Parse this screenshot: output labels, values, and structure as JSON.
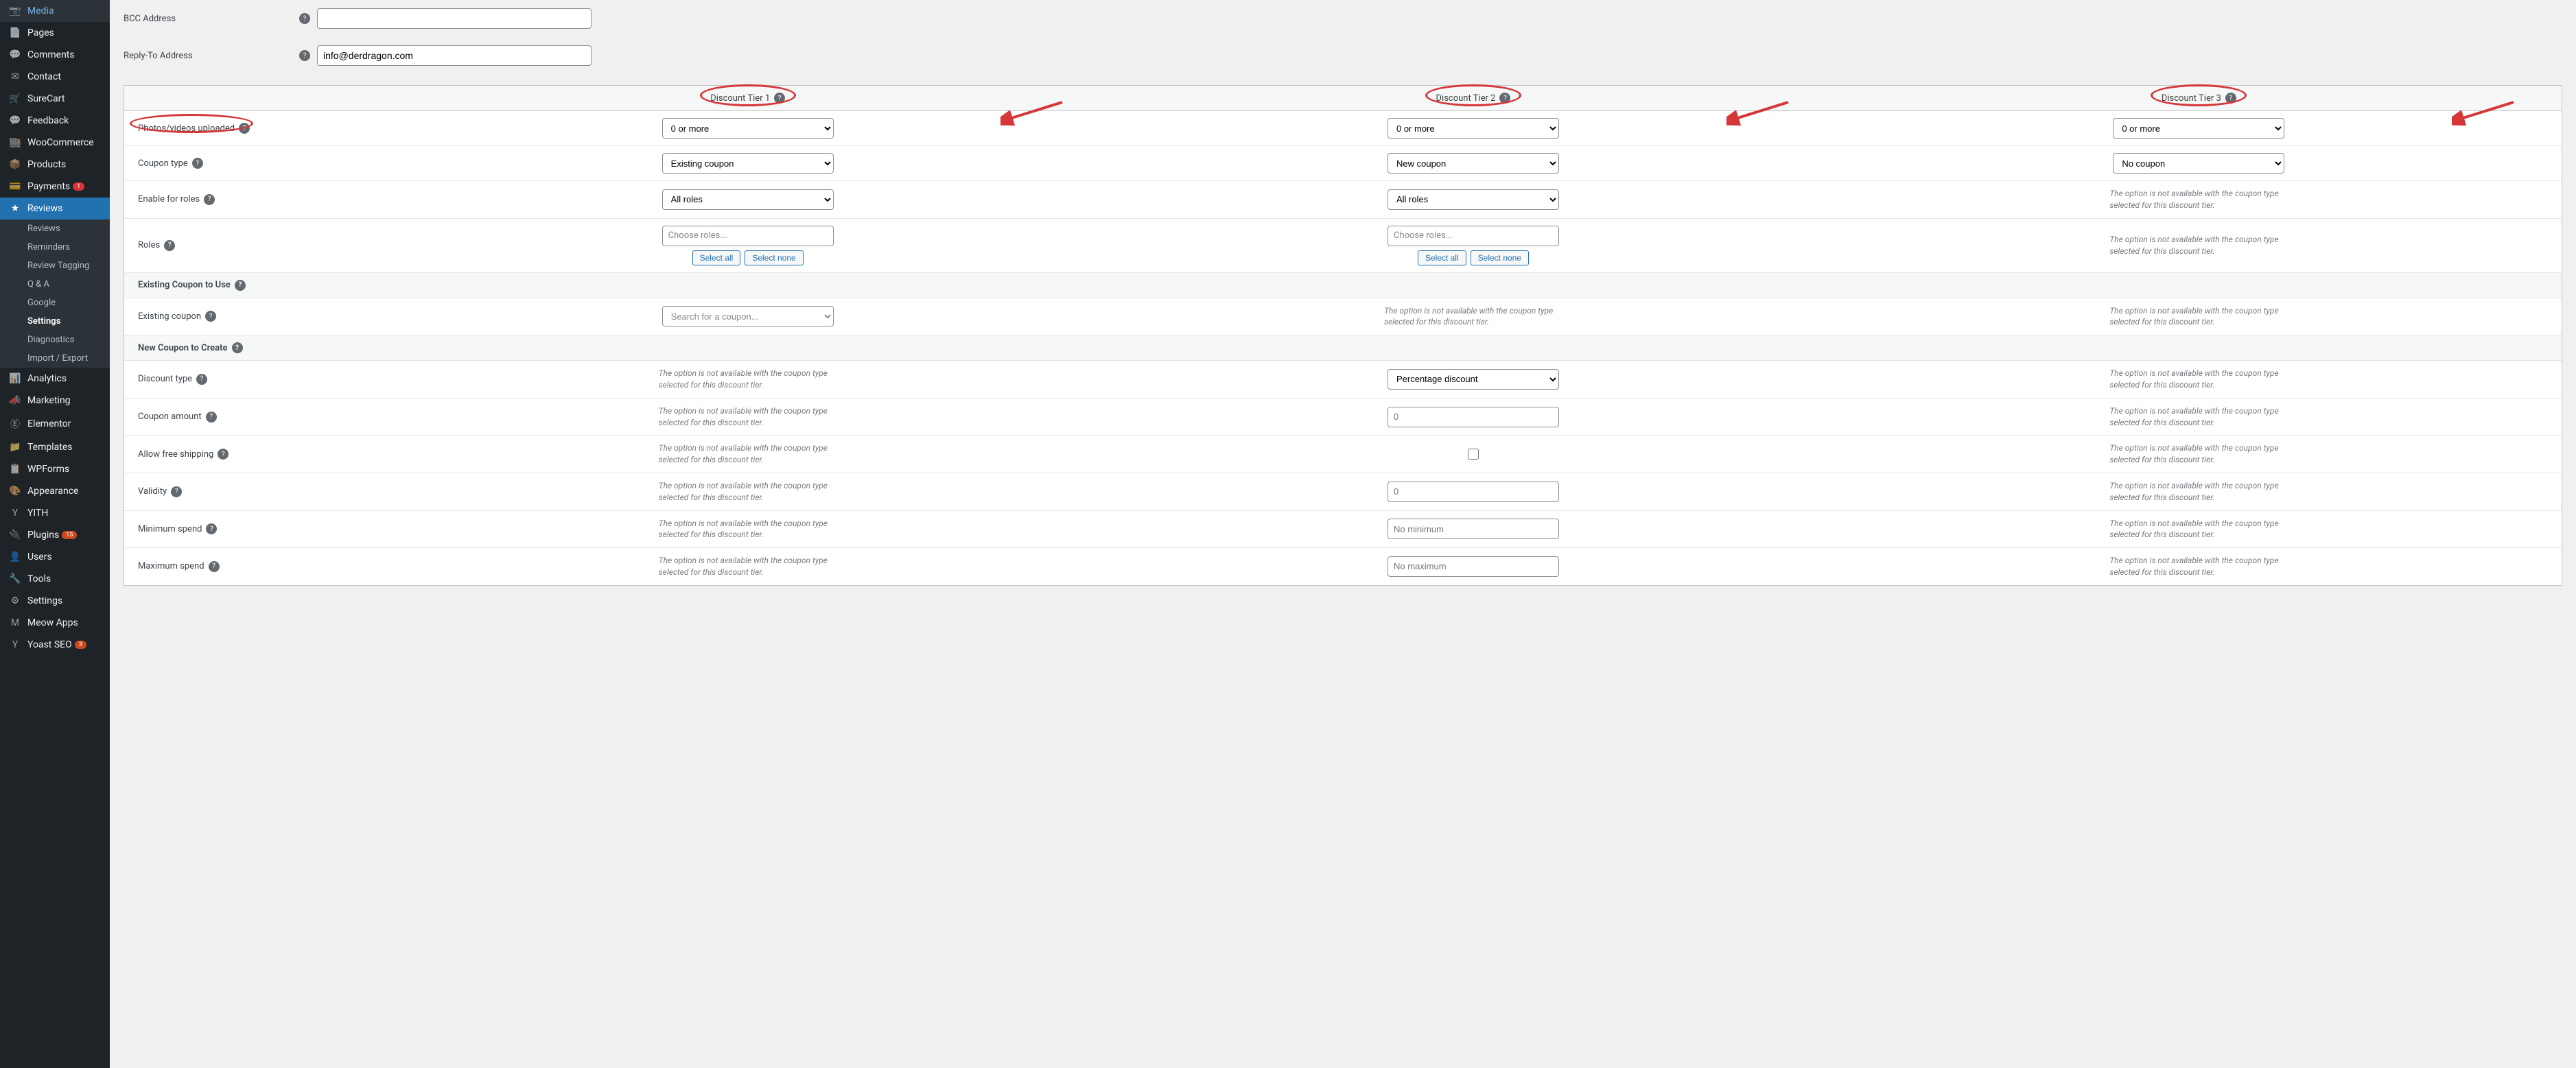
{
  "sidebar": {
    "items": [
      {
        "icon": "📷",
        "label": "Media"
      },
      {
        "icon": "📄",
        "label": "Pages"
      },
      {
        "icon": "💬",
        "label": "Comments"
      },
      {
        "icon": "✉",
        "label": "Contact"
      },
      {
        "icon": "🛒",
        "label": "SureCart"
      },
      {
        "icon": "💬",
        "label": "Feedback"
      },
      {
        "icon": "🏬",
        "label": "WooCommerce"
      },
      {
        "icon": "📦",
        "label": "Products"
      },
      {
        "icon": "💳",
        "label": "Payments",
        "badge": "1"
      },
      {
        "icon": "★",
        "label": "Reviews",
        "active": true
      }
    ],
    "submenu": [
      "Reviews",
      "Reminders",
      "Review Tagging",
      "Q & A",
      "Google",
      "Settings",
      "Diagnostics",
      "Import / Export"
    ],
    "submenu_current": "Settings",
    "items_after": [
      {
        "icon": "📊",
        "label": "Analytics"
      },
      {
        "icon": "📣",
        "label": "Marketing"
      },
      {
        "icon": "Ⓔ",
        "label": "Elementor"
      },
      {
        "icon": "📁",
        "label": "Templates"
      },
      {
        "icon": "📋",
        "label": "WPForms"
      },
      {
        "icon": "🎨",
        "label": "Appearance"
      },
      {
        "icon": "Y",
        "label": "YITH"
      },
      {
        "icon": "🔌",
        "label": "Plugins",
        "badge": "15",
        "badge_class": "orange"
      },
      {
        "icon": "👤",
        "label": "Users"
      },
      {
        "icon": "🔧",
        "label": "Tools"
      },
      {
        "icon": "⚙",
        "label": "Settings"
      },
      {
        "icon": "M",
        "label": "Meow Apps"
      },
      {
        "icon": "Y",
        "label": "Yoast SEO",
        "badge": "3",
        "badge_class": "orange"
      }
    ]
  },
  "top_fields": {
    "bcc_label": "BCC Address",
    "bcc_value": "",
    "reply_to_label": "Reply-To Address",
    "reply_to_value": "info@derdragon.com"
  },
  "tiers": {
    "headers": [
      "Discount Tier 1",
      "Discount Tier 2",
      "Discount Tier 3"
    ],
    "rows": {
      "photos": {
        "label": "Photos/videos uploaded",
        "val": "0 or more"
      },
      "coupon_type": {
        "label": "Coupon type",
        "vals": [
          "Existing coupon",
          "New coupon",
          "No coupon"
        ]
      },
      "enable_roles": {
        "label": "Enable for roles",
        "val": "All roles"
      },
      "roles": {
        "label": "Roles",
        "placeholder": "Choose roles...",
        "select_all": "Select all",
        "select_none": "Select none"
      }
    },
    "existing_section": "Existing Coupon to Use",
    "existing_coupon": {
      "label": "Existing coupon",
      "placeholder": "Search for a coupon..."
    },
    "new_section": "New Coupon to Create",
    "discount_type": {
      "label": "Discount type",
      "val": "Percentage discount"
    },
    "coupon_amount": {
      "label": "Coupon amount",
      "placeholder": "0"
    },
    "allow_free_shipping": {
      "label": "Allow free shipping"
    },
    "validity": {
      "label": "Validity",
      "placeholder": "0"
    },
    "min_spend": {
      "label": "Minimum spend",
      "placeholder": "No minimum"
    },
    "max_spend": {
      "label": "Maximum spend",
      "placeholder": "No maximum"
    },
    "na_text": "The option is not available with the coupon type selected for this discount tier."
  },
  "help_glyph": "?"
}
